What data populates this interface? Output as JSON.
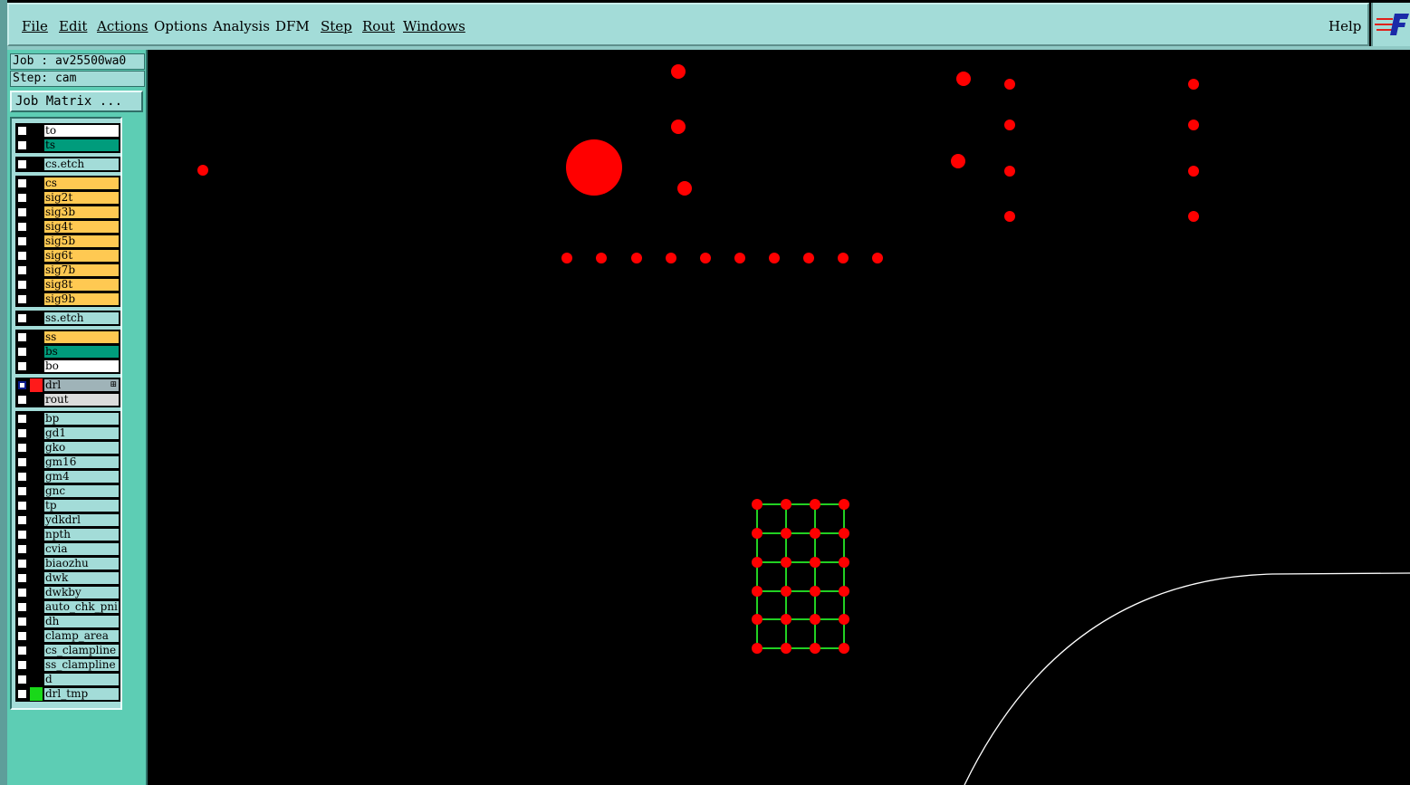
{
  "menu": {
    "file": "File",
    "edit": "Edit",
    "actions": "Actions",
    "options": "Options",
    "analysis": "Analysis",
    "dfm": "DFM",
    "step": "Step",
    "rout": "Rout",
    "windows": "Windows",
    "help": "Help"
  },
  "job": {
    "job_label": "Job : av25500wa0",
    "step_label": "Step: cam",
    "matrix_button": "Job Matrix ..."
  },
  "layers": [
    {
      "name": "to",
      "color": "#ffffff",
      "group": 1
    },
    {
      "name": "ts",
      "color": "#009c7c",
      "group": 1
    },
    {
      "name": "cs.etch",
      "color": "#a3dcd8",
      "group": 2
    },
    {
      "name": "cs",
      "color": "#ffc952",
      "group": 3
    },
    {
      "name": "sig2t",
      "color": "#ffc952",
      "group": 3
    },
    {
      "name": "sig3b",
      "color": "#ffc952",
      "group": 3
    },
    {
      "name": "sig4t",
      "color": "#ffc952",
      "group": 3
    },
    {
      "name": "sig5b",
      "color": "#ffc952",
      "group": 3
    },
    {
      "name": "sig6t",
      "color": "#ffc952",
      "group": 3
    },
    {
      "name": "sig7b",
      "color": "#ffc952",
      "group": 3
    },
    {
      "name": "sig8t",
      "color": "#ffc952",
      "group": 3
    },
    {
      "name": "sig9b",
      "color": "#ffc952",
      "group": 3
    },
    {
      "name": "ss.etch",
      "color": "#a3dcd8",
      "group": 4
    },
    {
      "name": "ss",
      "color": "#ffc952",
      "group": 5
    },
    {
      "name": "bs",
      "color": "#009c7c",
      "group": 5
    },
    {
      "name": "bo",
      "color": "#ffffff",
      "group": 5
    },
    {
      "name": "drl",
      "color": "#9fb3b8",
      "group": 6,
      "active": true,
      "swatch": "#ff1a1a"
    },
    {
      "name": "rout",
      "color": "#dcdcdc",
      "group": 6
    },
    {
      "name": "bp",
      "color": "#a3dcd8",
      "group": 7
    },
    {
      "name": "gd1",
      "color": "#a3dcd8",
      "group": 7
    },
    {
      "name": "gko",
      "color": "#a3dcd8",
      "group": 7
    },
    {
      "name": "gm16",
      "color": "#a3dcd8",
      "group": 7
    },
    {
      "name": "gm4",
      "color": "#a3dcd8",
      "group": 7
    },
    {
      "name": "gnc",
      "color": "#a3dcd8",
      "group": 7
    },
    {
      "name": "tp",
      "color": "#a3dcd8",
      "group": 7
    },
    {
      "name": "ydkdrl",
      "color": "#a3dcd8",
      "group": 7
    },
    {
      "name": "npth",
      "color": "#a3dcd8",
      "group": 7
    },
    {
      "name": "cvia",
      "color": "#a3dcd8",
      "group": 7
    },
    {
      "name": "biaozhu",
      "color": "#a3dcd8",
      "group": 7
    },
    {
      "name": "dwk",
      "color": "#a3dcd8",
      "group": 7
    },
    {
      "name": "dwkby",
      "color": "#a3dcd8",
      "group": 7
    },
    {
      "name": "auto_chk_pni",
      "color": "#a3dcd8",
      "group": 7
    },
    {
      "name": "dh",
      "color": "#a3dcd8",
      "group": 7
    },
    {
      "name": "clamp_area",
      "color": "#a3dcd8",
      "group": 7
    },
    {
      "name": "cs_clampline",
      "color": "#a3dcd8",
      "group": 7
    },
    {
      "name": "ss_clampline",
      "color": "#a3dcd8",
      "group": 7
    },
    {
      "name": "d",
      "color": "#a3dcd8",
      "group": 7
    },
    {
      "name": "drl_tmp",
      "color": "#a3dcd8",
      "group": 7,
      "swatch": "#19d819"
    }
  ],
  "colors": {
    "pad": "#ff0000",
    "grid_line": "#22d022",
    "outline": "#ffffff"
  }
}
